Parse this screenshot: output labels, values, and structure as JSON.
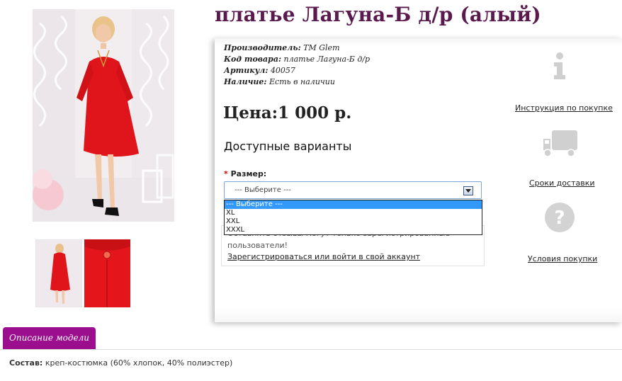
{
  "product": {
    "title": "платье Лагуна-Б д/р (алый)"
  },
  "specs": [
    {
      "label": "Производитель:",
      "value": "ТМ Glem"
    },
    {
      "label": "Код товара:",
      "value": "платье Лагуна-Б д/р"
    },
    {
      "label": "Артикул:",
      "value": "40057"
    },
    {
      "label": "Наличие:",
      "value": "Есть в наличии"
    }
  ],
  "price": "Цена:1 000 р.",
  "variants_heading": "Доступные варианты",
  "size": {
    "required_mark": "*",
    "label": "Размер:",
    "selected": "--- Выберите ---",
    "options": [
      "--- Выберите ---",
      "XL",
      "XXL",
      "XXXL"
    ]
  },
  "notice": {
    "line1": "Оставлять отзывы могут только зарегистрированные",
    "line2": "пользователи!",
    "link": "Зарегистрироваться или войти в свой аккаунт"
  },
  "right_column": {
    "items": [
      {
        "icon": "info-icon",
        "label": "Инструкция по покупке"
      },
      {
        "icon": "truck-icon",
        "label": "Сроки доставки"
      },
      {
        "icon": "question-icon",
        "label": "Условия покупки"
      }
    ]
  },
  "tabs": [
    {
      "label": "Описание модели"
    }
  ],
  "description": {
    "label": "Состав:",
    "text": "креп-костюмка (60% хлопок, 40% полиэстер)"
  },
  "colors": {
    "title": "#5b1a4e",
    "tab": "#9b0e8e",
    "dress": "#e0151b",
    "selected_option": "#3399ff"
  }
}
